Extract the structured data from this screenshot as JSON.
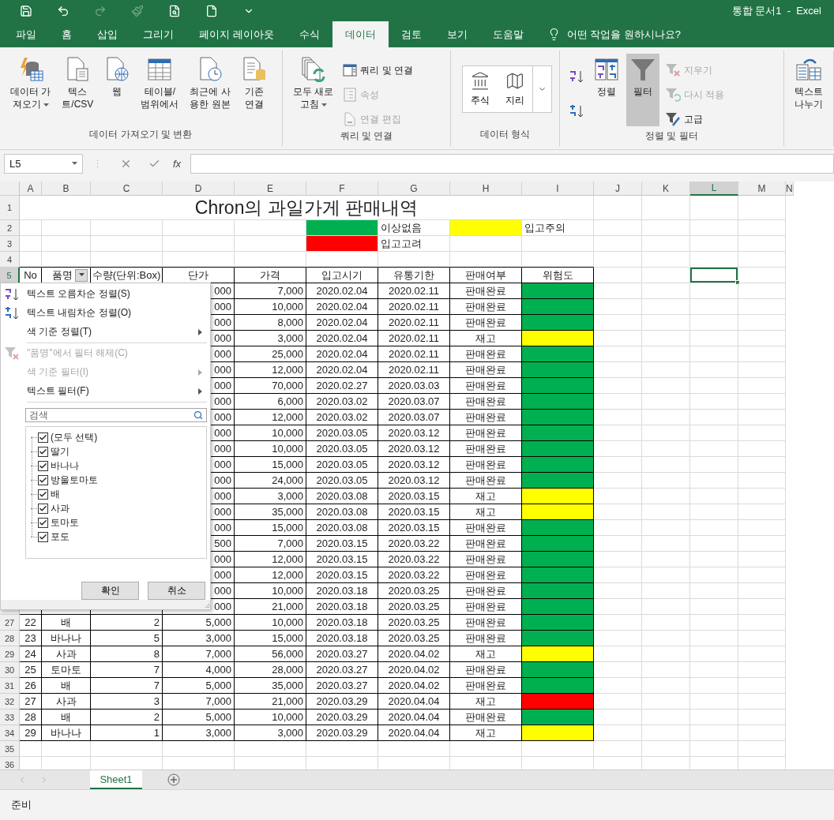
{
  "title_bar": {
    "title": "통합 문서1  -  Excel"
  },
  "tabs": [
    {
      "label": "파일",
      "selected": false
    },
    {
      "label": "홈",
      "selected": false
    },
    {
      "label": "삽입",
      "selected": false
    },
    {
      "label": "그리기",
      "selected": false
    },
    {
      "label": "페이지 레이아웃",
      "selected": false
    },
    {
      "label": "수식",
      "selected": false
    },
    {
      "label": "데이터",
      "selected": true
    },
    {
      "label": "검토",
      "selected": false
    },
    {
      "label": "보기",
      "selected": false
    },
    {
      "label": "도움말",
      "selected": false
    }
  ],
  "tell_me": {
    "placeholder": "어떤 작업을 원하시나요?"
  },
  "ribbon": {
    "groups": [
      {
        "label": "데이터 가져오기 및 변환",
        "buttons": [
          {
            "kind": "large",
            "label": "데이터 가\n져오기",
            "dropdown": true
          },
          {
            "kind": "large",
            "label": "텍스\n트/CSV",
            "dropdown": false
          },
          {
            "kind": "large",
            "label": "웹",
            "dropdown": false
          },
          {
            "kind": "large",
            "label": "테이블/\n범위에서",
            "dropdown": false
          },
          {
            "kind": "large",
            "label": "최근에 사\n용한 원본",
            "dropdown": false
          },
          {
            "kind": "large",
            "label": "기존\n연결",
            "dropdown": false
          }
        ]
      },
      {
        "label": "쿼리 및 연결",
        "buttons": [
          {
            "kind": "large",
            "label": "모두 새로\n고침",
            "dropdown": true
          },
          {
            "kind": "small",
            "label": "쿼리 및 연결",
            "disabled": false
          },
          {
            "kind": "small",
            "label": "속성",
            "disabled": true
          },
          {
            "kind": "small",
            "label": "연결 편집",
            "disabled": true
          }
        ]
      },
      {
        "label": "데이터 형식",
        "buttons": [
          {
            "kind": "gallery",
            "items": [
              {
                "label": "주식"
              },
              {
                "label": "지리"
              }
            ]
          }
        ]
      },
      {
        "label": "정렬 및 필터",
        "buttons": [
          {
            "kind": "icon"
          },
          {
            "kind": "icon"
          },
          {
            "kind": "large",
            "label": "정렬",
            "selected": false
          },
          {
            "kind": "large",
            "label": "필터",
            "selected": true
          },
          {
            "kind": "small",
            "label": "지우기",
            "disabled": true
          },
          {
            "kind": "small",
            "label": "다시 적용",
            "disabled": true
          },
          {
            "kind": "small",
            "label": "고급",
            "disabled": false
          }
        ]
      },
      {
        "buttons": [
          {
            "kind": "large",
            "label": "텍스트\n나누기"
          }
        ]
      }
    ]
  },
  "formula_bar": {
    "name_box": "L5",
    "function_label": "fx"
  },
  "sheet": {
    "columns": [
      {
        "label": "A",
        "selected": false
      },
      {
        "label": "B",
        "selected": false
      },
      {
        "label": "C",
        "selected": false
      },
      {
        "label": "D",
        "selected": false
      },
      {
        "label": "E",
        "selected": false
      },
      {
        "label": "F",
        "selected": false
      },
      {
        "label": "G",
        "selected": false
      },
      {
        "label": "H",
        "selected": false
      },
      {
        "label": "I",
        "selected": false
      },
      {
        "label": "J",
        "selected": false
      },
      {
        "label": "K",
        "selected": false
      },
      {
        "label": "L",
        "selected": true
      },
      {
        "label": "M",
        "selected": false
      },
      {
        "label": "N",
        "selected": false
      }
    ],
    "top_rows": [
      {
        "label": "1",
        "selected": false
      },
      {
        "label": "2",
        "selected": false
      },
      {
        "label": "3",
        "selected": false
      },
      {
        "label": "4",
        "selected": false
      },
      {
        "label": "5",
        "selected": true
      }
    ],
    "title": "Chron의 과일가게 판매내역",
    "legend": [
      {
        "color": "#00b050",
        "label": "이상없음"
      },
      {
        "color": "#ffff00",
        "label": "입고주의"
      },
      {
        "color": "#ff0000",
        "label": "입고고려"
      }
    ],
    "headers": [
      {
        "label": "No",
        "filter_button": false
      },
      {
        "label": "품명",
        "filter_button": true
      },
      {
        "label": "수량(단위:Box)",
        "filter_button": false
      },
      {
        "label": "단가",
        "filter_button": false
      },
      {
        "label": "가격",
        "filter_button": false
      },
      {
        "label": "입고시기",
        "filter_button": false
      },
      {
        "label": "유통기한",
        "filter_button": false
      },
      {
        "label": "판매여부",
        "filter_button": false
      },
      {
        "label": "위험도",
        "filter_button": false
      }
    ],
    "trailing_rows": [
      "35",
      "36"
    ]
  },
  "table": {
    "rows": [
      {
        "unit_price": "000",
        "price": "7,000",
        "in_date": "2020.02.04",
        "expiry": "2020.02.11",
        "status": "판매완료",
        "color": "#00b050"
      },
      {
        "unit_price": "000",
        "price": "10,000",
        "in_date": "2020.02.04",
        "expiry": "2020.02.11",
        "status": "판매완료",
        "color": "#00b050"
      },
      {
        "unit_price": "000",
        "price": "8,000",
        "in_date": "2020.02.04",
        "expiry": "2020.02.11",
        "status": "판매완료",
        "color": "#00b050"
      },
      {
        "unit_price": "000",
        "price": "3,000",
        "in_date": "2020.02.04",
        "expiry": "2020.02.11",
        "status": "재고",
        "color": "#ffff00"
      },
      {
        "unit_price": "000",
        "price": "25,000",
        "in_date": "2020.02.04",
        "expiry": "2020.02.11",
        "status": "판매완료",
        "color": "#00b050"
      },
      {
        "unit_price": "000",
        "price": "12,000",
        "in_date": "2020.02.04",
        "expiry": "2020.02.11",
        "status": "판매완료",
        "color": "#00b050"
      },
      {
        "unit_price": "000",
        "price": "70,000",
        "in_date": "2020.02.27",
        "expiry": "2020.03.03",
        "status": "판매완료",
        "color": "#00b050"
      },
      {
        "unit_price": "000",
        "price": "6,000",
        "in_date": "2020.03.02",
        "expiry": "2020.03.07",
        "status": "판매완료",
        "color": "#00b050"
      },
      {
        "unit_price": "000",
        "price": "12,000",
        "in_date": "2020.03.02",
        "expiry": "2020.03.07",
        "status": "판매완료",
        "color": "#00b050"
      },
      {
        "unit_price": "000",
        "price": "10,000",
        "in_date": "2020.03.05",
        "expiry": "2020.03.12",
        "status": "판매완료",
        "color": "#00b050"
      },
      {
        "unit_price": "000",
        "price": "10,000",
        "in_date": "2020.03.05",
        "expiry": "2020.03.12",
        "status": "판매완료",
        "color": "#00b050"
      },
      {
        "unit_price": "000",
        "price": "15,000",
        "in_date": "2020.03.05",
        "expiry": "2020.03.12",
        "status": "판매완료",
        "color": "#00b050"
      },
      {
        "unit_price": "000",
        "price": "24,000",
        "in_date": "2020.03.05",
        "expiry": "2020.03.12",
        "status": "판매완료",
        "color": "#00b050"
      },
      {
        "unit_price": "000",
        "price": "3,000",
        "in_date": "2020.03.08",
        "expiry": "2020.03.15",
        "status": "재고",
        "color": "#ffff00"
      },
      {
        "unit_price": "000",
        "price": "35,000",
        "in_date": "2020.03.08",
        "expiry": "2020.03.15",
        "status": "재고",
        "color": "#ffff00"
      },
      {
        "unit_price": "000",
        "price": "15,000",
        "in_date": "2020.03.08",
        "expiry": "2020.03.15",
        "status": "판매완료",
        "color": "#00b050"
      },
      {
        "unit_price": "500",
        "price": "7,000",
        "in_date": "2020.03.15",
        "expiry": "2020.03.22",
        "status": "판매완료",
        "color": "#00b050"
      },
      {
        "unit_price": "000",
        "price": "12,000",
        "in_date": "2020.03.15",
        "expiry": "2020.03.22",
        "status": "판매완료",
        "color": "#00b050"
      },
      {
        "unit_price": "000",
        "price": "12,000",
        "in_date": "2020.03.15",
        "expiry": "2020.03.22",
        "status": "판매완료",
        "color": "#00b050"
      },
      {
        "unit_price": "000",
        "price": "10,000",
        "in_date": "2020.03.18",
        "expiry": "2020.03.25",
        "status": "판매완료",
        "color": "#00b050"
      },
      {
        "unit_price": "000",
        "price": "21,000",
        "in_date": "2020.03.18",
        "expiry": "2020.03.25",
        "status": "판매완료",
        "color": "#00b050"
      },
      {
        "row_label": "27",
        "no": "22",
        "item": "배",
        "qty": "2",
        "unit_price": "5,000",
        "price": "10,000",
        "in_date": "2020.03.18",
        "expiry": "2020.03.25",
        "status": "판매완료",
        "color": "#00b050"
      },
      {
        "row_label": "28",
        "no": "23",
        "item": "바나나",
        "qty": "5",
        "unit_price": "3,000",
        "price": "15,000",
        "in_date": "2020.03.18",
        "expiry": "2020.03.25",
        "status": "판매완료",
        "color": "#00b050"
      },
      {
        "row_label": "29",
        "no": "24",
        "item": "사과",
        "qty": "8",
        "unit_price": "7,000",
        "price": "56,000",
        "in_date": "2020.03.27",
        "expiry": "2020.04.02",
        "status": "재고",
        "color": "#ffff00"
      },
      {
        "row_label": "30",
        "no": "25",
        "item": "토마토",
        "qty": "7",
        "unit_price": "4,000",
        "price": "28,000",
        "in_date": "2020.03.27",
        "expiry": "2020.04.02",
        "status": "판매완료",
        "color": "#00b050"
      },
      {
        "row_label": "31",
        "no": "26",
        "item": "배",
        "qty": "7",
        "unit_price": "5,000",
        "price": "35,000",
        "in_date": "2020.03.27",
        "expiry": "2020.04.02",
        "status": "판매완료",
        "color": "#00b050"
      },
      {
        "row_label": "32",
        "no": "27",
        "item": "사과",
        "qty": "3",
        "unit_price": "7,000",
        "price": "21,000",
        "in_date": "2020.03.29",
        "expiry": "2020.04.04",
        "status": "재고",
        "color": "#ff0000"
      },
      {
        "row_label": "33",
        "no": "28",
        "item": "배",
        "qty": "2",
        "unit_price": "5,000",
        "price": "10,000",
        "in_date": "2020.03.29",
        "expiry": "2020.04.04",
        "status": "판매완료",
        "color": "#00b050"
      },
      {
        "row_label": "34",
        "no": "29",
        "item": "바나나",
        "qty": "1",
        "unit_price": "3,000",
        "price": "3,000",
        "in_date": "2020.03.29",
        "expiry": "2020.04.04",
        "status": "재고",
        "color": "#ffff00"
      }
    ]
  },
  "filter_menu": {
    "groups": [
      [
        {
          "kind": "sort_asc",
          "label": "텍스트 오름차순 정렬(S)",
          "disabled": false,
          "submenu": false
        },
        {
          "kind": "sort_desc",
          "label": "텍스트 내림차순 정렬(O)",
          "disabled": false,
          "submenu": false
        },
        {
          "kind": "plain",
          "label": "색 기준 정렬(T)",
          "disabled": false,
          "submenu": true
        }
      ],
      [
        {
          "kind": "clear",
          "label": "\"품명\"에서 필터 해제(C)",
          "disabled": true,
          "submenu": false
        },
        {
          "kind": "plain",
          "label": "색 기준 필터(I)",
          "disabled": true,
          "submenu": true
        },
        {
          "kind": "plain",
          "label": "텍스트 필터(F)",
          "disabled": false,
          "submenu": true
        }
      ]
    ],
    "search": {
      "placeholder": "검색"
    },
    "values": [
      {
        "label": "(모두 선택)",
        "checked": true
      },
      {
        "label": "딸기",
        "checked": true
      },
      {
        "label": "바나나",
        "checked": true
      },
      {
        "label": "방울토마토",
        "checked": true
      },
      {
        "label": "배",
        "checked": true
      },
      {
        "label": "사과",
        "checked": true
      },
      {
        "label": "토마토",
        "checked": true
      },
      {
        "label": "포도",
        "checked": true
      }
    ],
    "buttons": [
      "확인",
      "취소"
    ]
  },
  "sheet_tabs": [
    {
      "label": "Sheet1",
      "selected": true
    }
  ],
  "status_bar": {
    "text": "준비"
  }
}
